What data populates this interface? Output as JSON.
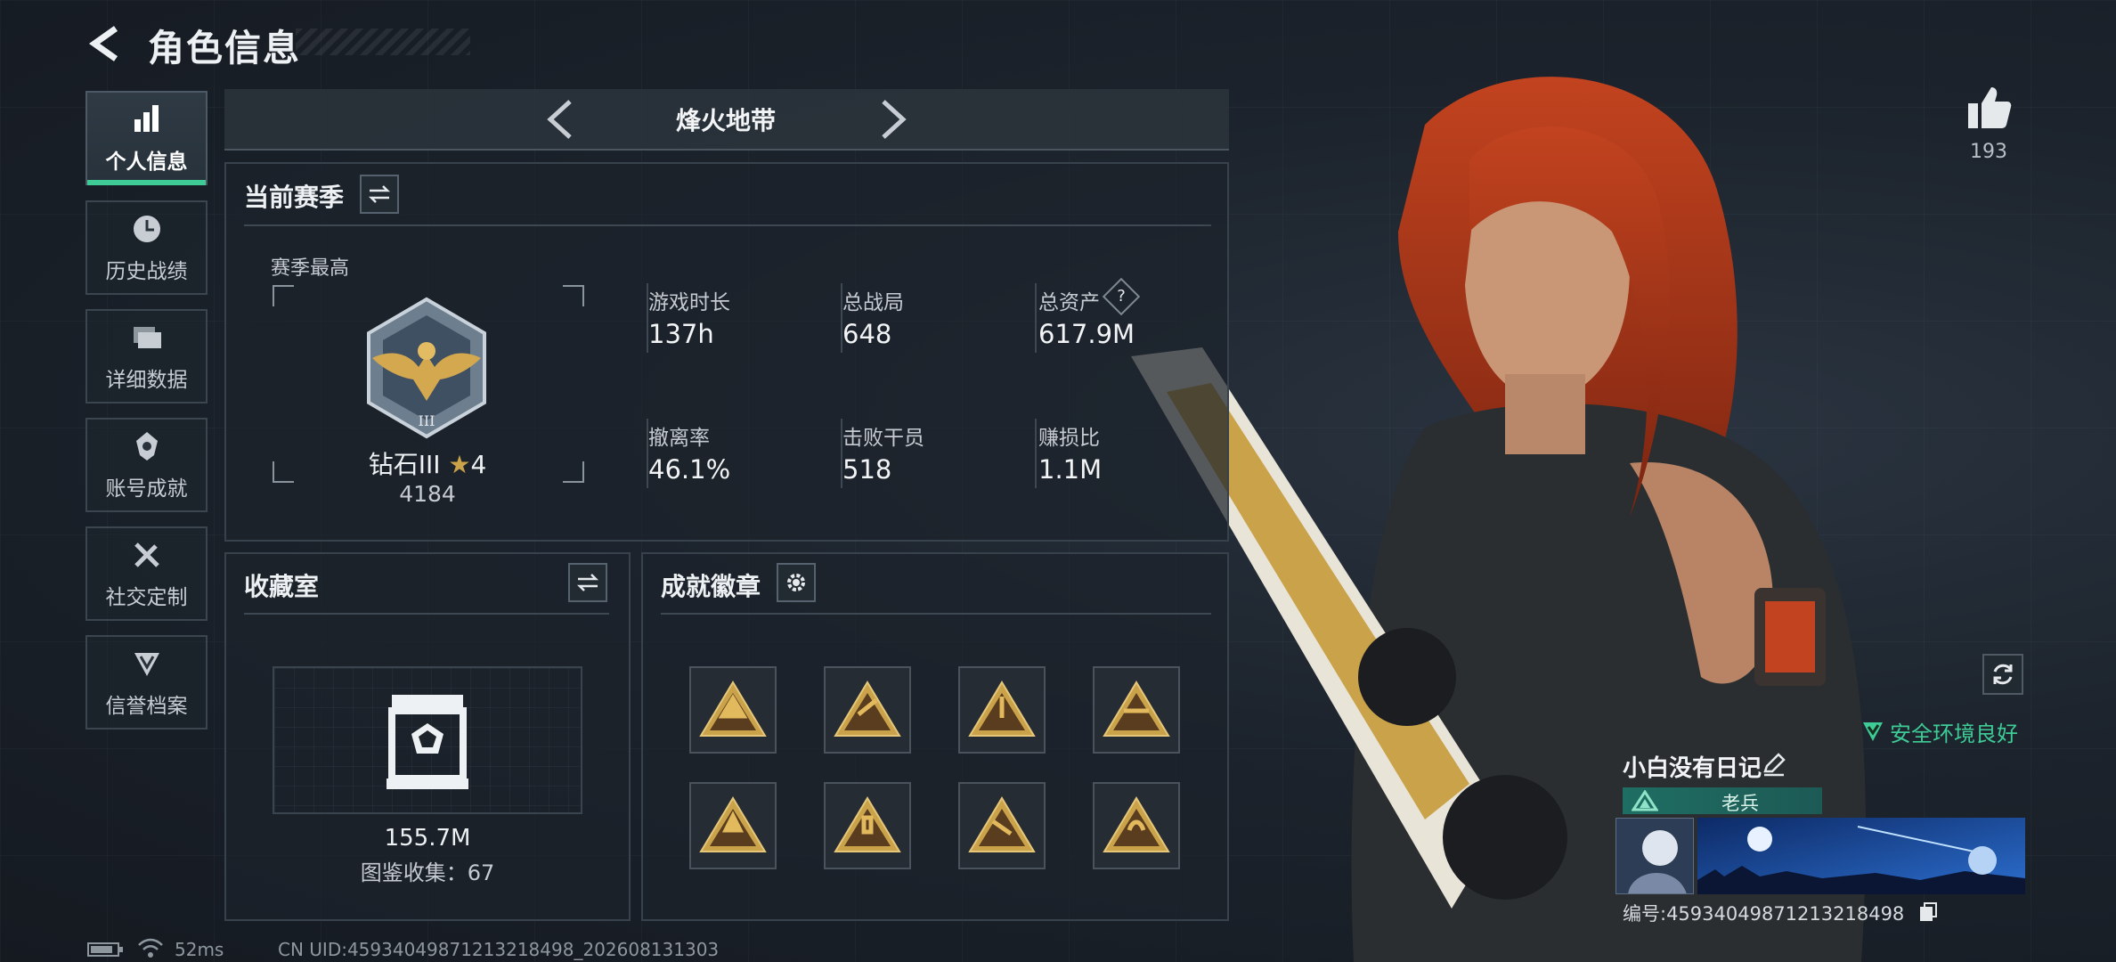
{
  "header": {
    "title": "角色信息"
  },
  "nav": {
    "items": [
      {
        "label": "个人信息",
        "icon": "bar-chart-icon",
        "active": true
      },
      {
        "label": "历史战绩",
        "icon": "history-clock-icon"
      },
      {
        "label": "详细数据",
        "icon": "folders-icon"
      },
      {
        "label": "账号成就",
        "icon": "achievement-icon"
      },
      {
        "label": "社交定制",
        "icon": "tools-icon"
      },
      {
        "label": "信誉档案",
        "icon": "credibility-icon"
      }
    ]
  },
  "mode": {
    "name": "烽火地带"
  },
  "season": {
    "title": "当前赛季",
    "best_label": "赛季最高",
    "rank_name": "钻石III",
    "rank_stars": "4",
    "rank_score": "4184",
    "stats": [
      {
        "label": "游戏时长",
        "value": "137h"
      },
      {
        "label": "总战局",
        "value": "648"
      },
      {
        "label": "总资产",
        "value": "617.9M",
        "help": "?"
      },
      {
        "label": "撤离率",
        "value": "46.1%"
      },
      {
        "label": "击败干员",
        "value": "518"
      },
      {
        "label": "赚损比",
        "value": "1.1M"
      }
    ]
  },
  "collection": {
    "title": "收藏室",
    "value": "155.7M",
    "count_text": "图鉴收集：67"
  },
  "badges": {
    "title": "成就徽章",
    "count": 8
  },
  "likes": {
    "count": "193"
  },
  "profile": {
    "security_text": "安全环境良好",
    "nickname": "小白没有日记",
    "tag": "老兵",
    "id_text": "编号:459340498712132184​98"
  },
  "footer": {
    "ping": "52ms",
    "uid": "CN UID:459340498712132184​98_202608131303"
  },
  "colors": {
    "accent_green": "#3ecb96",
    "gold": "#c9a24a"
  }
}
